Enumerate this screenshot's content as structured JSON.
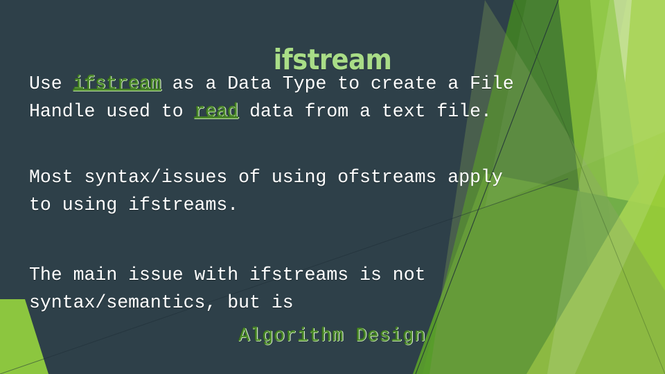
{
  "slide": {
    "title": "ifstream",
    "background_color": "#2e4049",
    "title_color": "#a9dd87",
    "body_color": "#ffffff",
    "accent_color": "#4d8c2c",
    "decor_colors": {
      "dark_green": "#3a6e27",
      "mid_green": "#5a9e2b",
      "leaf_green": "#76b22e",
      "light_green": "#8cc63f",
      "bright_green": "#9acd3b",
      "pale_green": "#b5d98f",
      "olive_overlay": "#6d8a4a",
      "hairline": "#1d2d36"
    }
  },
  "paragraphs": [
    {
      "id": "p1",
      "lines": [
        [
          {
            "text": "Use ",
            "style": "normal"
          },
          {
            "text": "ifstream",
            "style": "keyword"
          },
          {
            "text": " as a Data Type to create a File",
            "style": "normal"
          }
        ],
        [
          {
            "text": "Handle used to ",
            "style": "normal"
          },
          {
            "text": "read",
            "style": "keyword"
          },
          {
            "text": " data from a text file.",
            "style": "normal"
          }
        ]
      ]
    },
    {
      "id": "p2",
      "lines": [
        [
          {
            "text": "Most syntax/issues of using ofstreams apply",
            "style": "normal"
          }
        ],
        [
          {
            "text": "to using ifstreams.",
            "style": "normal"
          }
        ]
      ]
    },
    {
      "id": "p3",
      "lines": [
        [
          {
            "text": "The main issue with ifstreams is not",
            "style": "normal"
          }
        ],
        [
          {
            "text": "syntax/semantics, but is",
            "style": "normal"
          }
        ]
      ]
    }
  ],
  "closing": {
    "text": "Algorithm Design"
  }
}
